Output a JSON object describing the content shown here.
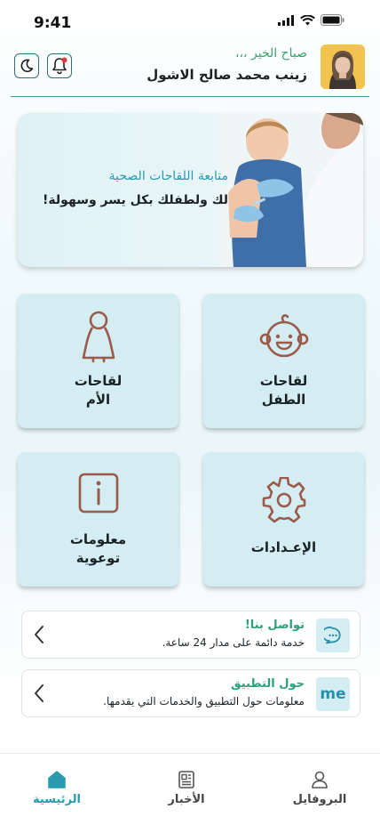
{
  "status_bar": {
    "time": "9:41"
  },
  "header": {
    "greeting": "صباح الخير ،،،",
    "user_name": "زينب محمد صالح الاشول"
  },
  "banner": {
    "title": "متابعة اللقاحات الصحية",
    "subtitle": "لك ولطفلك بكل يسر وسهولة!"
  },
  "tiles": [
    {
      "line1": "لقاحات",
      "line2": "الطفل",
      "icon": "baby-face-icon"
    },
    {
      "line1": "لقاحات",
      "line2": "الأم",
      "icon": "mother-icon"
    },
    {
      "line1": "الإعـدادات",
      "line2": "",
      "icon": "gear-icon"
    },
    {
      "line1": "معلومات",
      "line2": "توعوية",
      "icon": "info-icon"
    }
  ],
  "cards": [
    {
      "title": "تواصل بنا!",
      "description": "خدمة دائمة على مدار 24 ساعة.",
      "badge": "chat-icon"
    },
    {
      "title": "حول التطبيق",
      "description": "معلومات حول التطبيق والخدمات التي يقدمها.",
      "badge_text": "me"
    }
  ],
  "bottom_nav": [
    {
      "label": "الرئيسية",
      "icon": "home-icon",
      "active": true
    },
    {
      "label": "الأخبار",
      "icon": "news-icon",
      "active": false
    },
    {
      "label": "البروفايل",
      "icon": "profile-icon",
      "active": false
    }
  ],
  "colors": {
    "accent": "#2a9ab0",
    "tile_bg": "#d3edf2",
    "icon_brown": "#9b5a4a",
    "green_text": "#2d9f7a"
  }
}
